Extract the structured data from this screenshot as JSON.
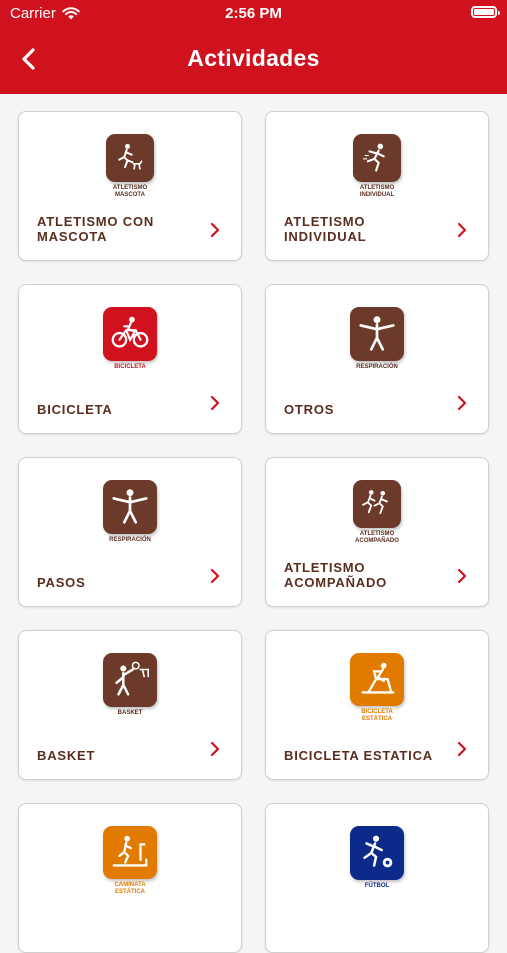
{
  "status_bar": {
    "carrier": "Carrier",
    "time": "2:56 PM"
  },
  "header": {
    "title": "Actividades"
  },
  "colors": {
    "header": "#d0121f",
    "label": "#5a2e1f",
    "chevron": "#d0121f"
  },
  "activities": [
    {
      "label": "ATLETISMO CON MASCOTA",
      "icon": "runner-with-pet-icon",
      "icon_caption": "ATLETISMO MASCOTA",
      "icon_color": "#6b3a2a",
      "caption_color": "#5a2e1f"
    },
    {
      "label": "ATLETISMO INDIVIDUAL",
      "icon": "runner-icon",
      "icon_caption": "ATLETISMO INDIVIDUAL",
      "icon_color": "#6b3a2a",
      "caption_color": "#5a2e1f"
    },
    {
      "label": "BICICLETA",
      "icon": "bicycle-icon",
      "icon_caption": "BICICLETA",
      "icon_color": "#d0121f",
      "caption_color": "#d0121f"
    },
    {
      "label": "OTROS",
      "icon": "breathing-person-icon",
      "icon_caption": "RESPIRACIÓN",
      "icon_color": "#6b3a2a",
      "caption_color": "#5a2e1f"
    },
    {
      "label": "PASOS",
      "icon": "breathing-person-icon",
      "icon_caption": "RESPIRACIÓN",
      "icon_color": "#6b3a2a",
      "caption_color": "#5a2e1f"
    },
    {
      "label": "ATLETISMO ACOMPAÑADO",
      "icon": "two-runners-icon",
      "icon_caption": "ATLETISMO ACOMPAÑADO",
      "icon_color": "#6b3a2a",
      "caption_color": "#5a2e1f"
    },
    {
      "label": "BASKET",
      "icon": "basketball-player-icon",
      "icon_caption": "BASKET",
      "icon_color": "#6b3a2a",
      "caption_color": "#5a2e1f"
    },
    {
      "label": "BICICLETA ESTATICA",
      "icon": "stationary-bike-icon",
      "icon_caption": "BICICLETA ESTÁTICA",
      "icon_color": "#e07b00",
      "caption_color": "#e07b00"
    },
    {
      "label": "",
      "icon": "treadmill-icon",
      "icon_caption": "CAMINATA ESTÁTICA",
      "icon_color": "#e07b00",
      "caption_color": "#e07b00"
    },
    {
      "label": "",
      "icon": "soccer-player-icon",
      "icon_caption": "FÚTBOL",
      "icon_color": "#0b2a8a",
      "caption_color": "#0b2a8a"
    }
  ]
}
